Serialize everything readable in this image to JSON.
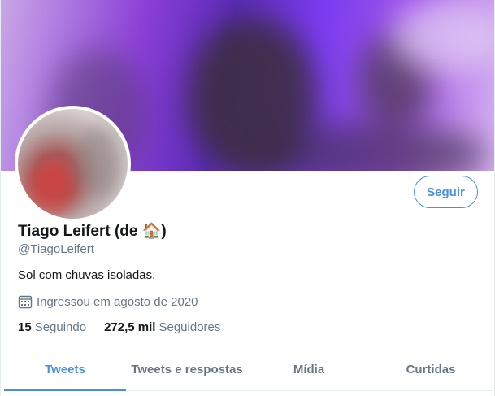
{
  "profile": {
    "name": "Tiago Leifert (de 🏠)",
    "handle": "@TiagoLeifert",
    "bio": "Sol com chuvas isoladas.",
    "joined": "Ingressou em agosto de 2020",
    "following_count": "15",
    "following_label": "Seguindo",
    "followers_count": "272,5 mil",
    "followers_label": "Seguidores"
  },
  "actions": {
    "follow_label": "Seguir"
  },
  "tabs": [
    {
      "label": "Tweets",
      "active": true
    },
    {
      "label": "Tweets e respostas",
      "active": false
    },
    {
      "label": "Mídia",
      "active": false
    },
    {
      "label": "Curtidas",
      "active": false
    }
  ],
  "colors": {
    "accent": "#4a90e2",
    "secondary_text": "#657786",
    "primary_text": "#14171a"
  },
  "icons": {
    "joined": "calendar-icon"
  }
}
